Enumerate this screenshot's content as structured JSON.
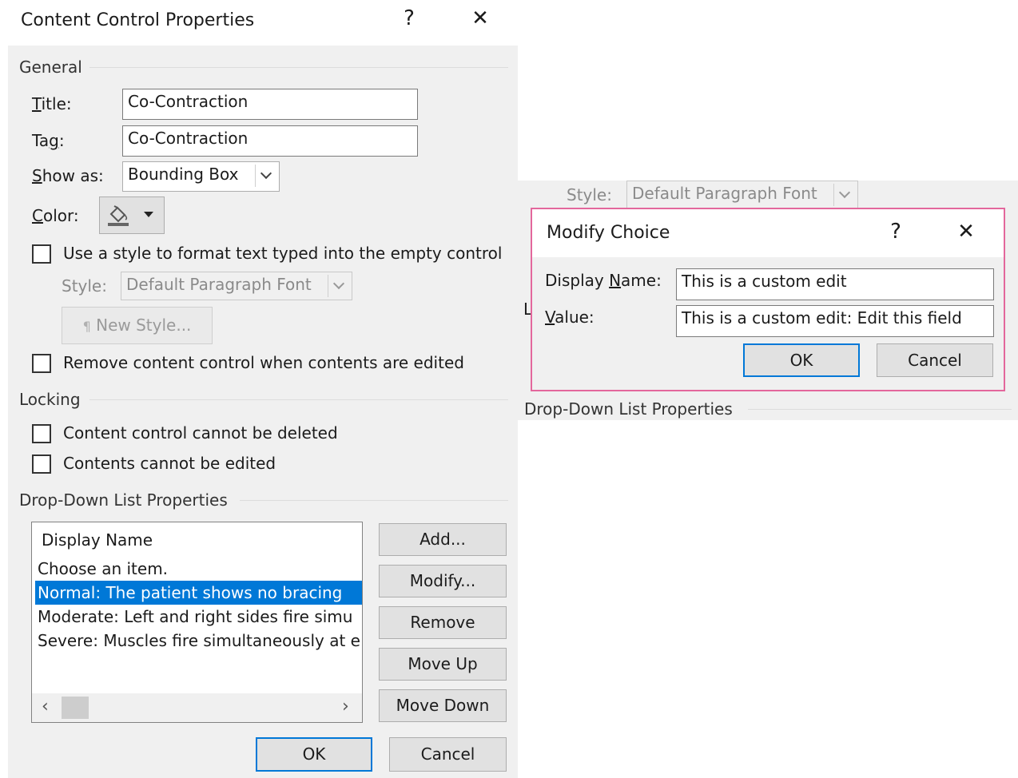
{
  "main_dialog": {
    "title": "Content Control Properties",
    "help_glyph": "?",
    "close_glyph": "✕",
    "general": {
      "section_label": "General",
      "title_label": "Title:",
      "title_value": "Co-Contraction",
      "tag_label": "Tag:",
      "tag_value": "Co-Contraction",
      "show_as_label": "Show as:",
      "show_as_value": "Bounding Box",
      "color_label": "Color:",
      "use_style_label": "Use a style to format text typed into the empty control",
      "style_label": "Style:",
      "style_value": "Default Paragraph Font",
      "new_style_label": "New Style...",
      "remove_control_label": "Remove content control when contents are edited"
    },
    "locking": {
      "section_label": "Locking",
      "cannot_delete_label": "Content control cannot be deleted",
      "cannot_edit_label": "Contents cannot be edited"
    },
    "dropdown": {
      "section_label": "Drop-Down List Properties",
      "column_header": "Display Name",
      "items": [
        {
          "label": "Choose an item.",
          "selected": false
        },
        {
          "label": "Normal:  The patient shows no bracing",
          "selected": true
        },
        {
          "label": "Moderate:  Left and right sides fire simu",
          "selected": false
        },
        {
          "label": "Severe:  Muscles fire simultaneously at e",
          "selected": false
        }
      ],
      "buttons": {
        "add": "Add...",
        "modify": "Modify...",
        "remove": "Remove",
        "move_up": "Move Up",
        "move_down": "Move Down"
      }
    },
    "ok_label": "OK",
    "cancel_label": "Cancel"
  },
  "background_dialog": {
    "style_label": "Style:",
    "style_value": "Default Paragraph Font",
    "partial_char": "L",
    "dropdown_section_label": "Drop-Down List Properties"
  },
  "modify_choice": {
    "title": "Modify Choice",
    "help_glyph": "?",
    "close_glyph": "✕",
    "display_name_label": "Display Name:",
    "display_name_value": "This is a custom edit",
    "value_label": "Value:",
    "value_value": "This is a custom edit: Edit this field",
    "ok_label": "OK",
    "cancel_label": "Cancel",
    "border_color": "#e3679c"
  },
  "colors": {
    "accent": "#0078d7",
    "dialog_bg": "#f0f0f0",
    "selection_text": "#ffffff"
  }
}
